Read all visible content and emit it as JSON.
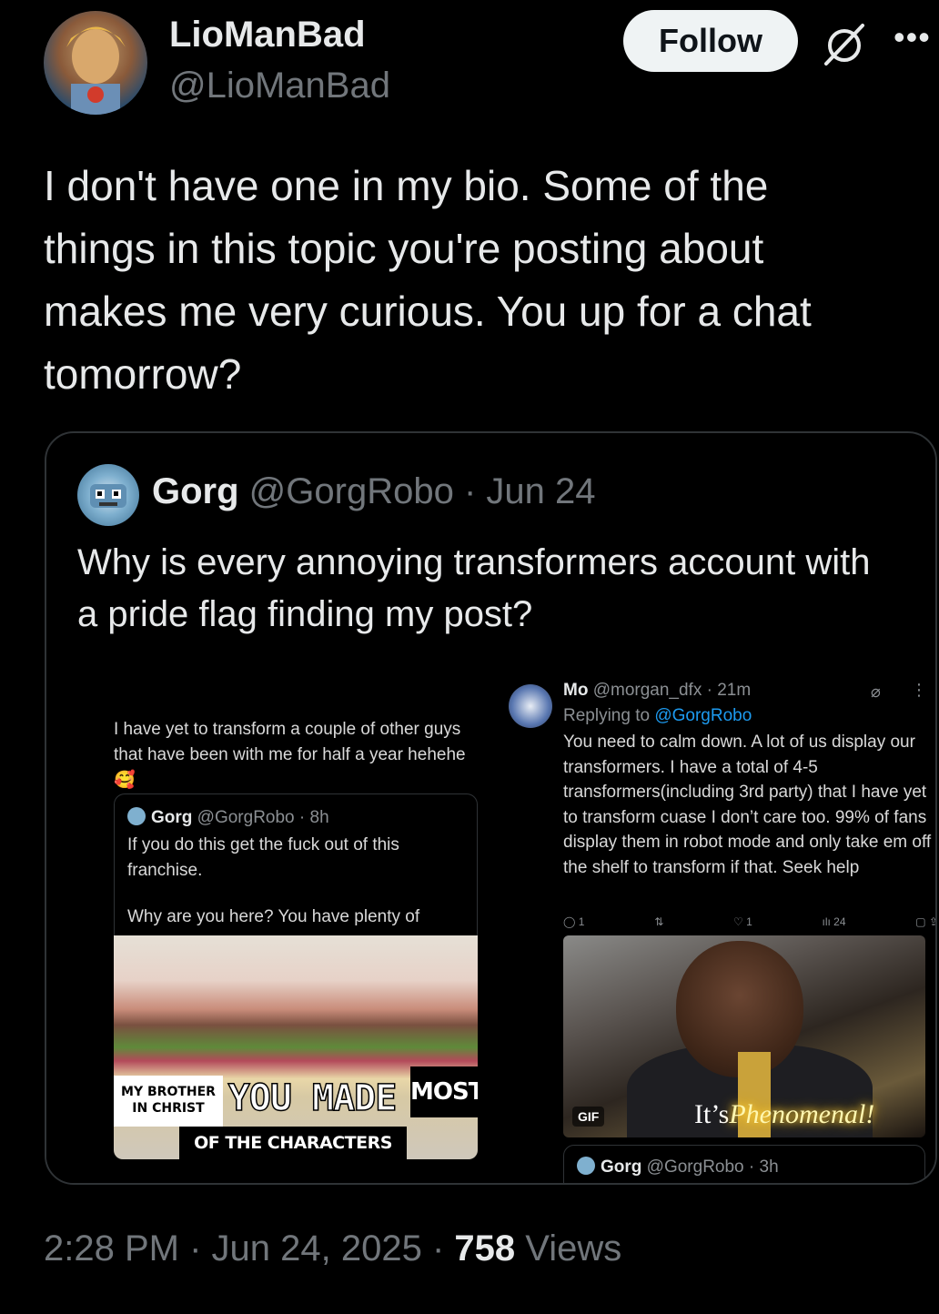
{
  "author": {
    "display_name": "LioManBad",
    "handle": "@LioManBad",
    "follow_label": "Follow"
  },
  "tweet": {
    "text": "I don't have one in my bio. Some of the things in this topic you're posting about makes me very curious. You up for a chat tomorrow?",
    "time": "2:28 PM",
    "date": "Jun 24, 2025",
    "views_count": "758",
    "views_label": "Views"
  },
  "quote": {
    "name": "Gorg",
    "handle": "@GorgRobo",
    "date": "Jun 24",
    "text": "Why is every annoying transformers account with a pride flag finding my post?",
    "screenshot": {
      "left_text": "I have yet to transform a couple of other guys that have been with me for half a year hehehe 🥰",
      "inner_card": {
        "name": "Gorg",
        "handle": "@GorgRobo",
        "time": "8h",
        "text": "If you do this get the fuck out of this franchise.",
        "text2": "Why are you here? You have plenty of"
      },
      "meme": {
        "left_label": "MY BROTHER IN CHRIST",
        "made": "YOU MADE",
        "most": "MOST",
        "bottom": "OF THE CHARACTERS MEN"
      },
      "reply": {
        "name": "Mo",
        "handle": "@morgan_dfx",
        "time": "21m",
        "replying_to_label": "Replying to",
        "replying_to": "@GorgRobo",
        "text": "You need to calm down. A lot of us display our transformers. I have a total of 4-5 transformers(including 3rd party) that I have yet to transform cuase I don’t care too. 99% of fans display them in robot mode and only take em off the shelf to transform if that. Seek help",
        "actions": {
          "replies": "1",
          "likes": "1",
          "views": "24"
        }
      },
      "gif": {
        "badge": "GIF",
        "caption_plain": "It’s",
        "caption_glow": "Phenomenal!"
      },
      "bottom_card": {
        "name": "Gorg",
        "handle": "@GorgRobo",
        "time": "3h"
      }
    }
  },
  "icons": {
    "grok": "grok-icon",
    "more": "more-icon"
  }
}
